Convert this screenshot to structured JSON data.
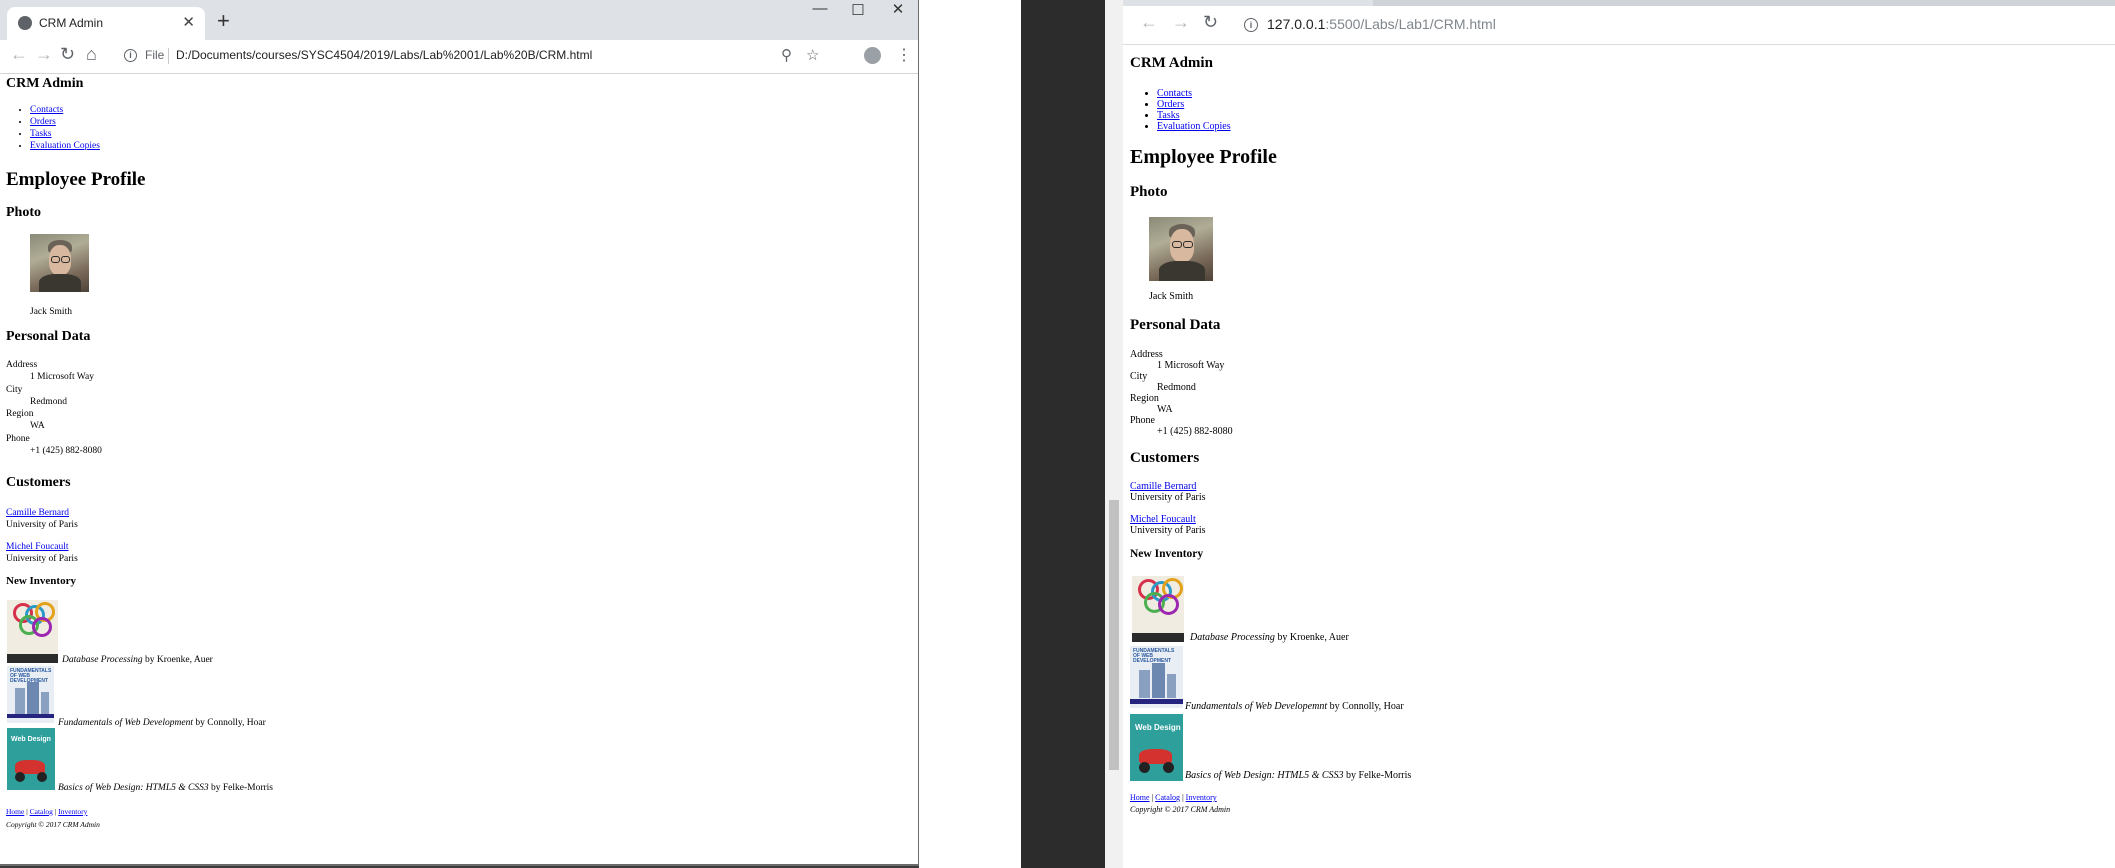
{
  "left_window": {
    "tab_title": "CRM Admin",
    "file_label": "File",
    "url": "D:/Documents/courses/SYSC4504/2019/Labs/Lab%2001/Lab%20B/CRM.html"
  },
  "right_window": {
    "url_host": "127.0.0.1",
    "url_rest": ":5500/Labs/Lab1/CRM.html"
  },
  "page": {
    "site_title": "CRM Admin",
    "nav": [
      "Contacts",
      "Orders",
      "Tasks",
      "Evaluation Copies"
    ],
    "heading": "Employee Profile",
    "photo_heading": "Photo",
    "employee_name": "Jack Smith",
    "personal_heading": "Personal Data",
    "personal": [
      {
        "label": "Address",
        "value": "1 Microsoft Way"
      },
      {
        "label": "City",
        "value": "Redmond"
      },
      {
        "label": "Region",
        "value": "WA"
      },
      {
        "label": "Phone",
        "value": "+1 (425) 882-8080"
      }
    ],
    "customers_heading": "Customers",
    "customers": [
      {
        "name": "Camille Bernard",
        "org": "University of Paris"
      },
      {
        "name": "Michel Foucault",
        "org": "University of Paris"
      }
    ],
    "inventory_heading": "New Inventory",
    "books": [
      {
        "title": "Database Processing",
        "by": "by",
        "authors": "Kroenke, Auer"
      },
      {
        "title_left": "Fundamentals of Web Development",
        "title_right": "Fundamentals of Web Developemnt",
        "by": "by",
        "authors": "Connolly, Hoar"
      },
      {
        "title": "Basics of Web Design: HTML5 & CSS3",
        "by": "by",
        "authors": "Felke-Morris"
      }
    ],
    "footer_links": [
      "Home",
      "Catalog",
      "Inventory"
    ],
    "footer_sep": "|",
    "copyright": "Copyright © 2017 CRM Admin"
  },
  "colors": {
    "link": "#0000ee",
    "tabstrip": "#dee1e6",
    "background": "#3c3c3c"
  }
}
